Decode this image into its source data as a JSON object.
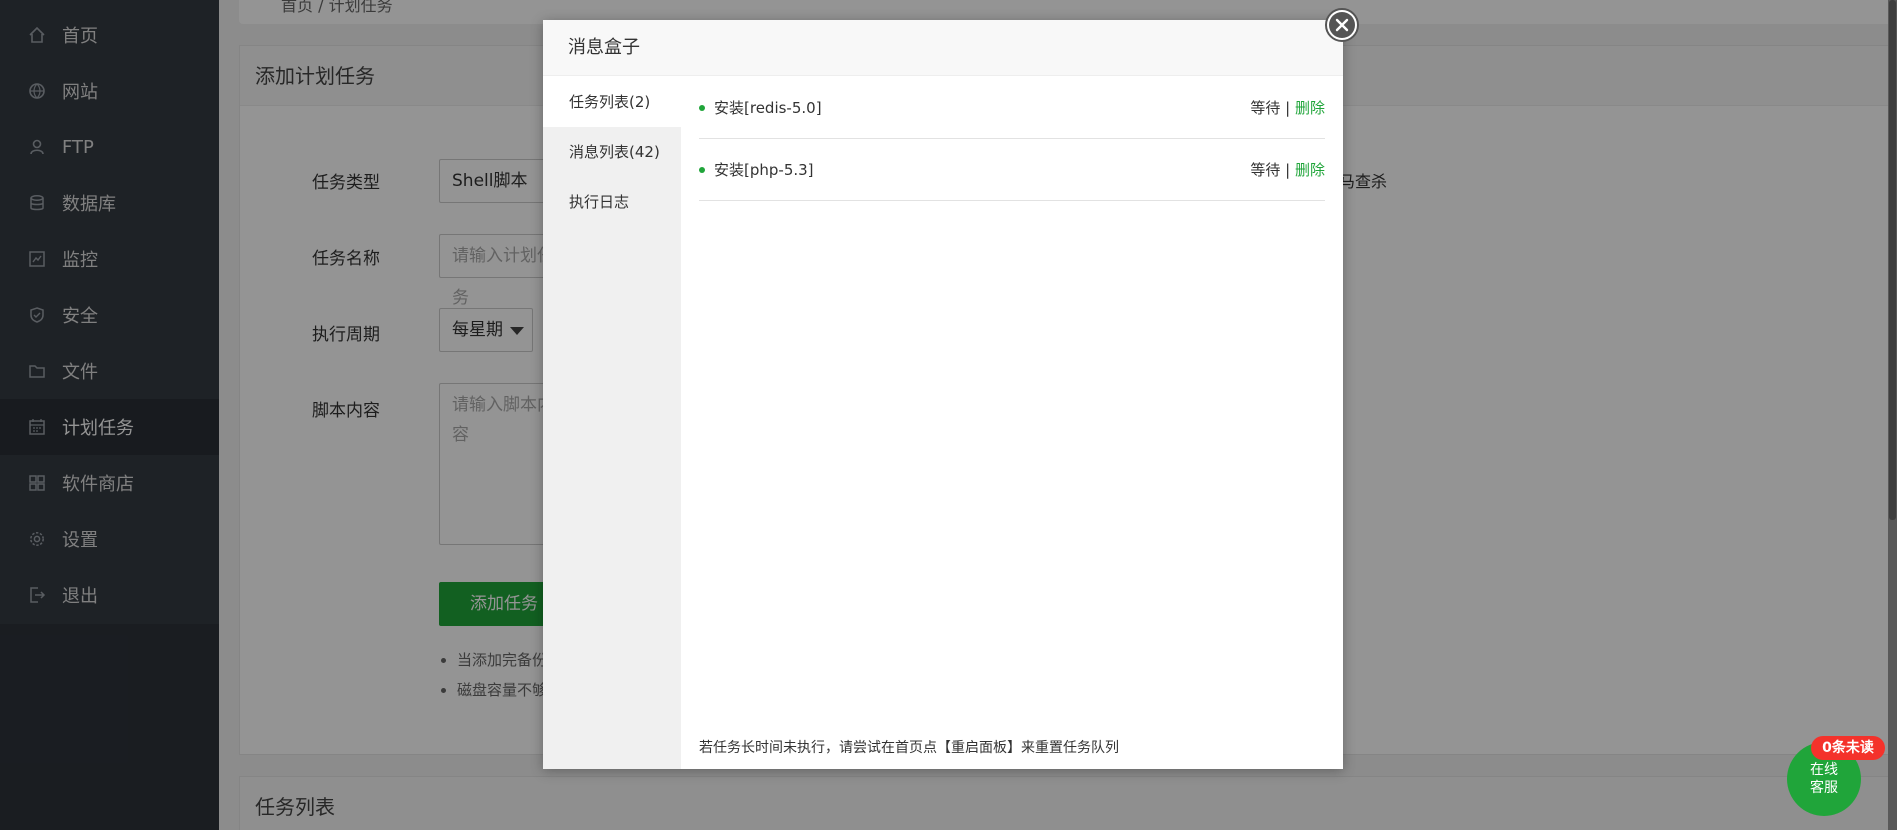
{
  "sidebar": {
    "items": [
      {
        "label": "首页",
        "icon": "home-icon"
      },
      {
        "label": "网站",
        "icon": "globe-icon"
      },
      {
        "label": "FTP",
        "icon": "ftp-icon"
      },
      {
        "label": "数据库",
        "icon": "database-icon"
      },
      {
        "label": "监控",
        "icon": "monitor-icon"
      },
      {
        "label": "安全",
        "icon": "shield-icon"
      },
      {
        "label": "文件",
        "icon": "folder-icon"
      },
      {
        "label": "计划任务",
        "icon": "calendar-icon",
        "active": true
      },
      {
        "label": "软件商店",
        "icon": "grid-icon"
      },
      {
        "label": "设置",
        "icon": "gear-icon"
      },
      {
        "label": "退出",
        "icon": "logout-icon"
      }
    ]
  },
  "breadcrumb": {
    "text": "首页 / 计划任务"
  },
  "form": {
    "title": "添加计划任务",
    "type_label": "任务类型",
    "type_value": "Shell脚本",
    "name_label": "任务名称",
    "name_placeholder": "请输入计划任务",
    "cycle_label": "执行周期",
    "cycle_value": "每星期",
    "script_label": "脚本内容",
    "script_placeholder": "请输入脚本内容",
    "submit_label": "添加任务",
    "right_note": "马查杀",
    "tips": [
      "当添加完备份任",
      "磁盘容量不够、"
    ]
  },
  "task_list_section": {
    "title": "任务列表"
  },
  "modal": {
    "title": "消息盒子",
    "tabs": [
      {
        "label": "任务列表(2)",
        "active": true
      },
      {
        "label": "消息列表(42)"
      },
      {
        "label": "执行日志"
      }
    ],
    "tasks": [
      {
        "name": "安装[redis-5.0]",
        "status": "等待",
        "sep": "|",
        "action": "删除"
      },
      {
        "name": "安装[php-5.3]",
        "status": "等待",
        "sep": "|",
        "action": "删除"
      }
    ],
    "footer_tip": "若任务长时间未执行，请尝试在首页点【重启面板】来重置任务队列"
  },
  "chat": {
    "label_line1": "在线",
    "label_line2": "客服",
    "badge": "0条未读"
  },
  "colors": {
    "accent": "#20a53a",
    "sidebar_bg": "#353b43",
    "badge": "#f4322b"
  }
}
